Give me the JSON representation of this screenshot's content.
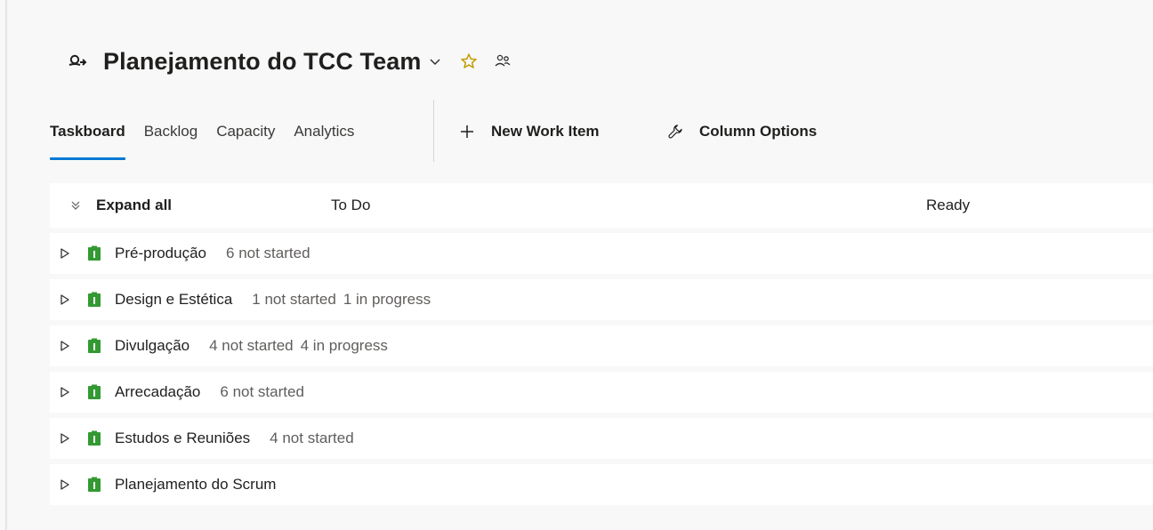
{
  "header": {
    "title": "Planejamento do TCC Team",
    "icons": [
      "team-icon",
      "chevron-down-icon",
      "star-icon",
      "people-icon"
    ]
  },
  "tabs": [
    {
      "label": "Taskboard",
      "active": true
    },
    {
      "label": "Backlog",
      "active": false
    },
    {
      "label": "Capacity",
      "active": false
    },
    {
      "label": "Analytics",
      "active": false
    }
  ],
  "commands": {
    "new_work_item": "New Work Item",
    "column_options": "Column Options"
  },
  "board": {
    "expand_all": "Expand all",
    "columns": [
      "To Do",
      "Ready"
    ],
    "rows": [
      {
        "name": "Pré-produção",
        "status": "6 not started",
        "status2": ""
      },
      {
        "name": "Design e Estética",
        "status": "1 not started",
        "status2": "1 in progress"
      },
      {
        "name": "Divulgação",
        "status": "4 not started",
        "status2": "4 in progress"
      },
      {
        "name": "Arrecadação",
        "status": "6 not started",
        "status2": ""
      },
      {
        "name": "Estudos e Reuniões",
        "status": "4 not started",
        "status2": ""
      },
      {
        "name": "Planejamento do Scrum",
        "status": "",
        "status2": ""
      }
    ]
  },
  "colors": {
    "accent": "#0078d4",
    "backlog_item_green": "#339933",
    "star": "#c19c00"
  }
}
